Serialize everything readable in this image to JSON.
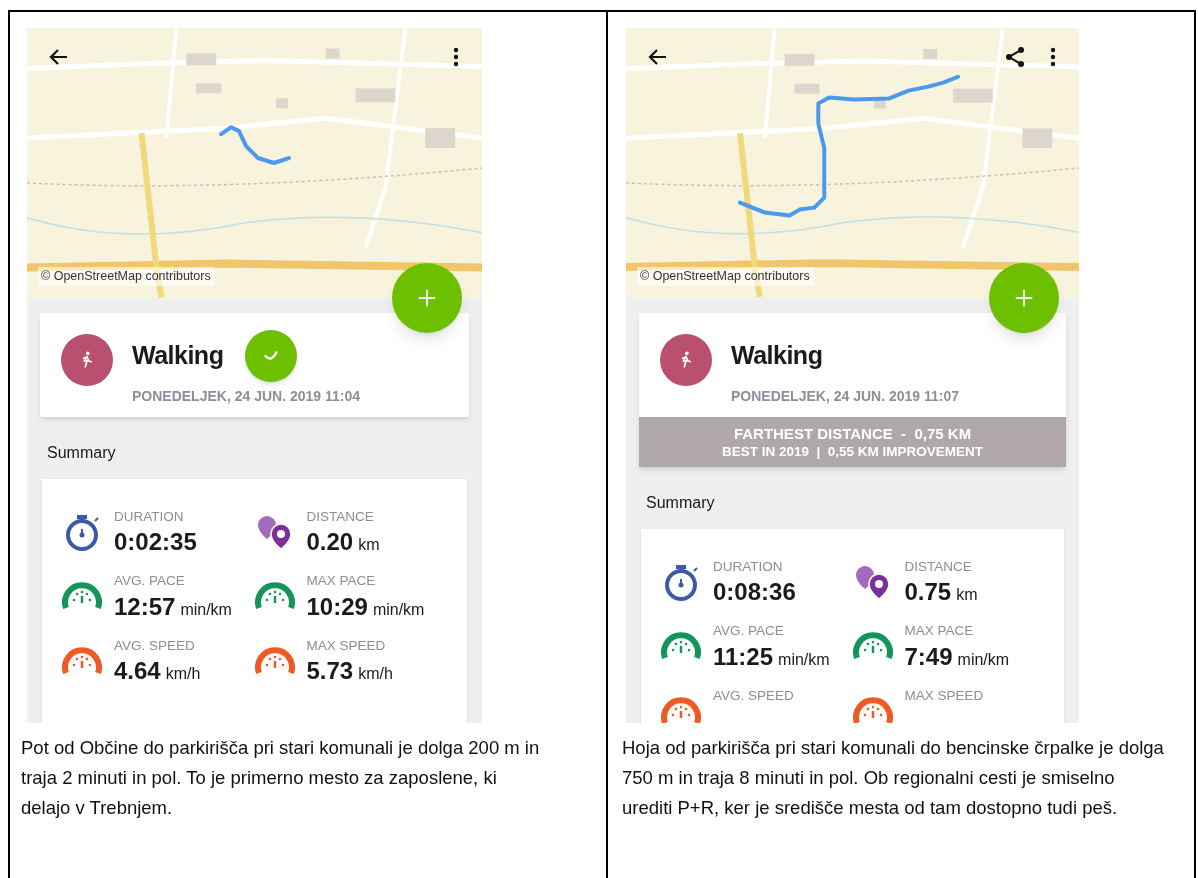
{
  "panels": [
    {
      "toolbar": [
        {
          "kind": "back"
        },
        {
          "kind": "more"
        }
      ],
      "map": {
        "attribution": "© OpenStreetMap contributors"
      },
      "activity": {
        "title": "Walking",
        "date": "PONEDELJEK, 24 JUN. 2019 11:04",
        "floating_bubble": true
      },
      "summary": {
        "heading": "Summary",
        "stats": [
          {
            "kind": "duration",
            "label": "DURATION",
            "value": "0:02:35"
          },
          {
            "kind": "distance",
            "label": "DISTANCE",
            "value": "0.20",
            "unit": "km"
          },
          {
            "kind": "pace",
            "label": "AVG. PACE",
            "value": "12:57",
            "unit": "min/km"
          },
          {
            "kind": "pace",
            "label": "MAX PACE",
            "value": "10:29",
            "unit": "min/km"
          },
          {
            "kind": "speed",
            "label": "AVG. SPEED",
            "value": "4.64",
            "unit": "km/h"
          },
          {
            "kind": "speed",
            "label": "MAX SPEED",
            "value": "5.73",
            "unit": "km/h"
          }
        ]
      },
      "caption": "Pot od Občine do parkirišča pri stari komunali je dolga 200 m in traja 2 minuti in pol. To je primerno mesto za zaposlene, ki delajo v Trebnjem."
    },
    {
      "toolbar": [
        {
          "kind": "back"
        },
        {
          "kind": "share"
        },
        {
          "kind": "more"
        }
      ],
      "map": {
        "attribution": "© OpenStreetMap contributors"
      },
      "activity": {
        "title": "Walking",
        "date": "PONEDELJEK, 24 JUN. 2019 11:07",
        "floating_bubble": false,
        "achievement": {
          "title": "FARTHEST DISTANCE  -  0,75 KM",
          "subtitle": "BEST IN 2019  |  0,55 KM IMPROVEMENT"
        }
      },
      "summary": {
        "heading": "Summary",
        "stats": [
          {
            "kind": "duration",
            "label": "DURATION",
            "value": "0:08:36"
          },
          {
            "kind": "distance",
            "label": "DISTANCE",
            "value": "0.75",
            "unit": "km"
          },
          {
            "kind": "pace",
            "label": "AVG. PACE",
            "value": "11:25",
            "unit": "min/km"
          },
          {
            "kind": "pace",
            "label": "MAX PACE",
            "value": "7:49",
            "unit": "min/km"
          },
          {
            "kind": "speed",
            "label": "AVG. SPEED"
          },
          {
            "kind": "speed",
            "label": "MAX SPEED"
          }
        ]
      },
      "caption": "Hoja od parkirišča pri stari komunali do bencinske črpalke je dolga 750 m in traja 8 minuti in pol. Ob regionalni cesti je smiselno urediti P+R, ker je središče mesta od tam dostopno tudi peš."
    }
  ]
}
